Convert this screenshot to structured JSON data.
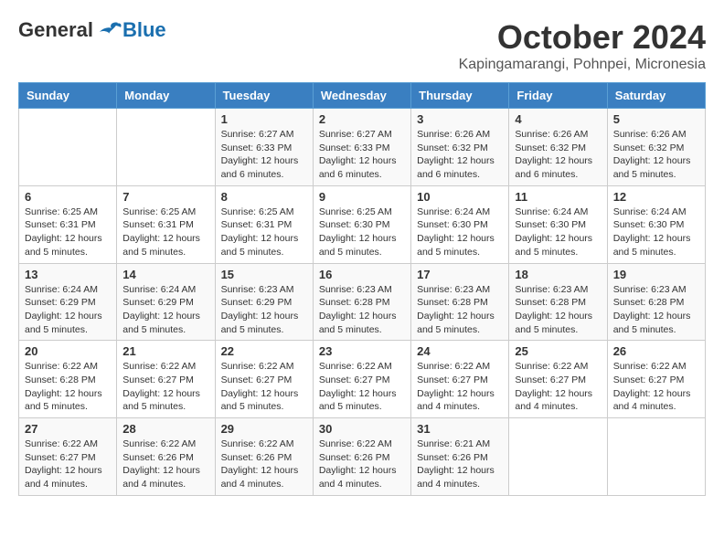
{
  "header": {
    "logo": {
      "general": "General",
      "blue": "Blue"
    },
    "title": "October 2024",
    "location": "Kapingamarangi, Pohnpei, Micronesia"
  },
  "days_of_week": [
    "Sunday",
    "Monday",
    "Tuesday",
    "Wednesday",
    "Thursday",
    "Friday",
    "Saturday"
  ],
  "weeks": [
    [
      {
        "day": "",
        "info": ""
      },
      {
        "day": "",
        "info": ""
      },
      {
        "day": "1",
        "info": "Sunrise: 6:27 AM\nSunset: 6:33 PM\nDaylight: 12 hours\nand 6 minutes."
      },
      {
        "day": "2",
        "info": "Sunrise: 6:27 AM\nSunset: 6:33 PM\nDaylight: 12 hours\nand 6 minutes."
      },
      {
        "day": "3",
        "info": "Sunrise: 6:26 AM\nSunset: 6:32 PM\nDaylight: 12 hours\nand 6 minutes."
      },
      {
        "day": "4",
        "info": "Sunrise: 6:26 AM\nSunset: 6:32 PM\nDaylight: 12 hours\nand 6 minutes."
      },
      {
        "day": "5",
        "info": "Sunrise: 6:26 AM\nSunset: 6:32 PM\nDaylight: 12 hours\nand 5 minutes."
      }
    ],
    [
      {
        "day": "6",
        "info": "Sunrise: 6:25 AM\nSunset: 6:31 PM\nDaylight: 12 hours\nand 5 minutes."
      },
      {
        "day": "7",
        "info": "Sunrise: 6:25 AM\nSunset: 6:31 PM\nDaylight: 12 hours\nand 5 minutes."
      },
      {
        "day": "8",
        "info": "Sunrise: 6:25 AM\nSunset: 6:31 PM\nDaylight: 12 hours\nand 5 minutes."
      },
      {
        "day": "9",
        "info": "Sunrise: 6:25 AM\nSunset: 6:30 PM\nDaylight: 12 hours\nand 5 minutes."
      },
      {
        "day": "10",
        "info": "Sunrise: 6:24 AM\nSunset: 6:30 PM\nDaylight: 12 hours\nand 5 minutes."
      },
      {
        "day": "11",
        "info": "Sunrise: 6:24 AM\nSunset: 6:30 PM\nDaylight: 12 hours\nand 5 minutes."
      },
      {
        "day": "12",
        "info": "Sunrise: 6:24 AM\nSunset: 6:30 PM\nDaylight: 12 hours\nand 5 minutes."
      }
    ],
    [
      {
        "day": "13",
        "info": "Sunrise: 6:24 AM\nSunset: 6:29 PM\nDaylight: 12 hours\nand 5 minutes."
      },
      {
        "day": "14",
        "info": "Sunrise: 6:24 AM\nSunset: 6:29 PM\nDaylight: 12 hours\nand 5 minutes."
      },
      {
        "day": "15",
        "info": "Sunrise: 6:23 AM\nSunset: 6:29 PM\nDaylight: 12 hours\nand 5 minutes."
      },
      {
        "day": "16",
        "info": "Sunrise: 6:23 AM\nSunset: 6:28 PM\nDaylight: 12 hours\nand 5 minutes."
      },
      {
        "day": "17",
        "info": "Sunrise: 6:23 AM\nSunset: 6:28 PM\nDaylight: 12 hours\nand 5 minutes."
      },
      {
        "day": "18",
        "info": "Sunrise: 6:23 AM\nSunset: 6:28 PM\nDaylight: 12 hours\nand 5 minutes."
      },
      {
        "day": "19",
        "info": "Sunrise: 6:23 AM\nSunset: 6:28 PM\nDaylight: 12 hours\nand 5 minutes."
      }
    ],
    [
      {
        "day": "20",
        "info": "Sunrise: 6:22 AM\nSunset: 6:28 PM\nDaylight: 12 hours\nand 5 minutes."
      },
      {
        "day": "21",
        "info": "Sunrise: 6:22 AM\nSunset: 6:27 PM\nDaylight: 12 hours\nand 5 minutes."
      },
      {
        "day": "22",
        "info": "Sunrise: 6:22 AM\nSunset: 6:27 PM\nDaylight: 12 hours\nand 5 minutes."
      },
      {
        "day": "23",
        "info": "Sunrise: 6:22 AM\nSunset: 6:27 PM\nDaylight: 12 hours\nand 5 minutes."
      },
      {
        "day": "24",
        "info": "Sunrise: 6:22 AM\nSunset: 6:27 PM\nDaylight: 12 hours\nand 4 minutes."
      },
      {
        "day": "25",
        "info": "Sunrise: 6:22 AM\nSunset: 6:27 PM\nDaylight: 12 hours\nand 4 minutes."
      },
      {
        "day": "26",
        "info": "Sunrise: 6:22 AM\nSunset: 6:27 PM\nDaylight: 12 hours\nand 4 minutes."
      }
    ],
    [
      {
        "day": "27",
        "info": "Sunrise: 6:22 AM\nSunset: 6:27 PM\nDaylight: 12 hours\nand 4 minutes."
      },
      {
        "day": "28",
        "info": "Sunrise: 6:22 AM\nSunset: 6:26 PM\nDaylight: 12 hours\nand 4 minutes."
      },
      {
        "day": "29",
        "info": "Sunrise: 6:22 AM\nSunset: 6:26 PM\nDaylight: 12 hours\nand 4 minutes."
      },
      {
        "day": "30",
        "info": "Sunrise: 6:22 AM\nSunset: 6:26 PM\nDaylight: 12 hours\nand 4 minutes."
      },
      {
        "day": "31",
        "info": "Sunrise: 6:21 AM\nSunset: 6:26 PM\nDaylight: 12 hours\nand 4 minutes."
      },
      {
        "day": "",
        "info": ""
      },
      {
        "day": "",
        "info": ""
      }
    ]
  ]
}
